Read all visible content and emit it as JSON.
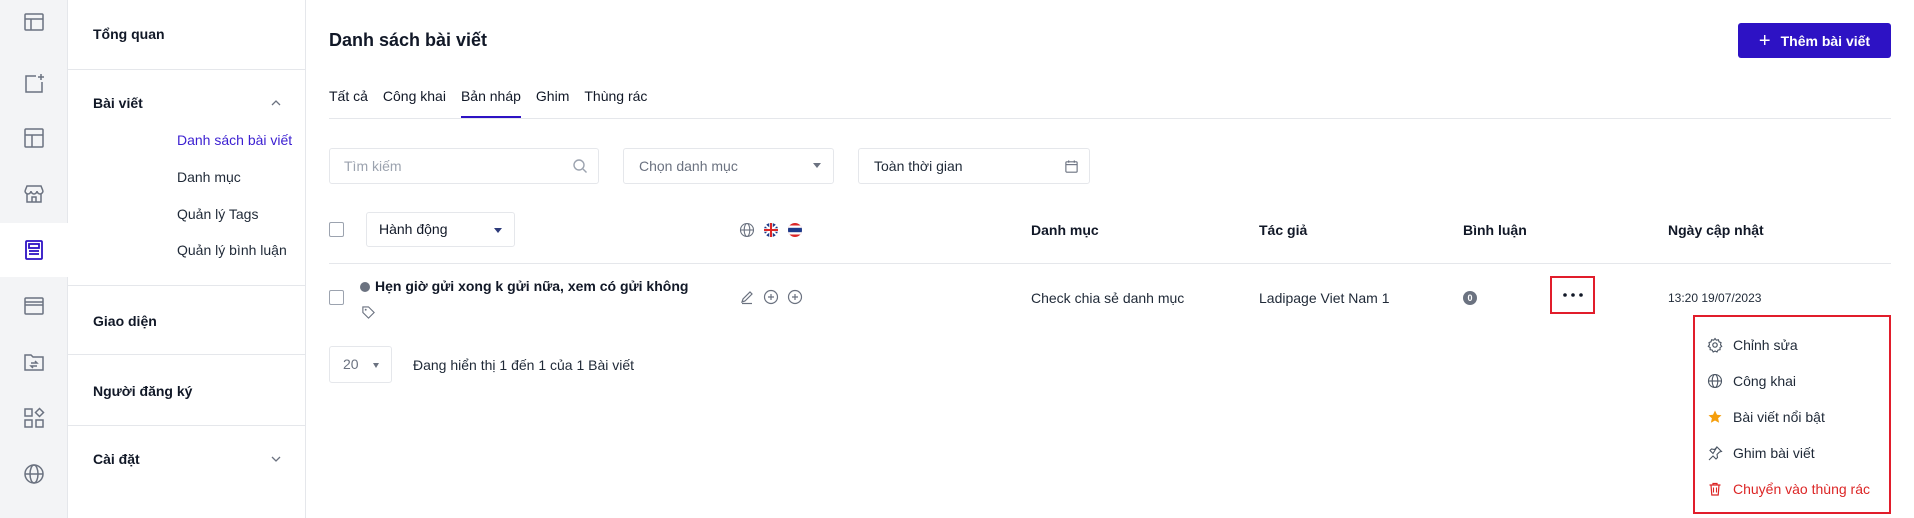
{
  "rail": {
    "icons": [
      "layout-icon",
      "add-page-icon",
      "template-icon",
      "store-icon",
      "blog-icon",
      "browser-icon",
      "folder-sync-icon",
      "apps-icon",
      "globe-icon"
    ],
    "active": "blog-icon"
  },
  "nav": {
    "overview": "Tổng quan",
    "posts": "Bài viết",
    "post_items": [
      "Danh sách bài viết",
      "Danh mục",
      "Quản lý Tags",
      "Quản lý bình luận"
    ],
    "interface": "Giao diện",
    "subscribers": "Người đăng ký",
    "settings": "Cài đặt"
  },
  "header": {
    "title": "Danh sách bài viết",
    "add_button": "Thêm bài viết"
  },
  "tabs": [
    "Tất cả",
    "Công khai",
    "Bản nháp",
    "Ghim",
    "Thùng rác"
  ],
  "active_tab": "Bản nháp",
  "filters": {
    "search_placeholder": "Tìm kiếm",
    "category_placeholder": "Chọn danh mục",
    "time_range": "Toàn thời gian"
  },
  "table": {
    "action_select": "Hành động",
    "columns": {
      "category": "Danh mục",
      "author": "Tác giả",
      "comments": "Bình luận",
      "updated": "Ngày cập nhật"
    },
    "rows": [
      {
        "title": "Hẹn giờ gửi xong k gửi nữa, xem có gửi không",
        "category": "Check chia sẻ danh mục",
        "author": "Ladipage Viet Nam 1",
        "comments": "0",
        "updated": "13:20 19/07/2023"
      }
    ]
  },
  "pagination": {
    "page_size": "20",
    "summary": "Đang hiển thị 1 đến 1 của 1 Bài viết"
  },
  "row_menu": {
    "items": [
      {
        "label": "Chỉnh sửa",
        "icon": "settings-icon"
      },
      {
        "label": "Công khai",
        "icon": "globe-icon"
      },
      {
        "label": "Bài viết nổi bật",
        "icon": "star-icon"
      },
      {
        "label": "Ghim bài viết",
        "icon": "pin-icon"
      },
      {
        "label": "Chuyển vào thùng rác",
        "icon": "trash-icon"
      }
    ]
  },
  "colors": {
    "primary": "#2d12c4",
    "highlight": "#e11d2b",
    "star": "#f59e0b"
  }
}
